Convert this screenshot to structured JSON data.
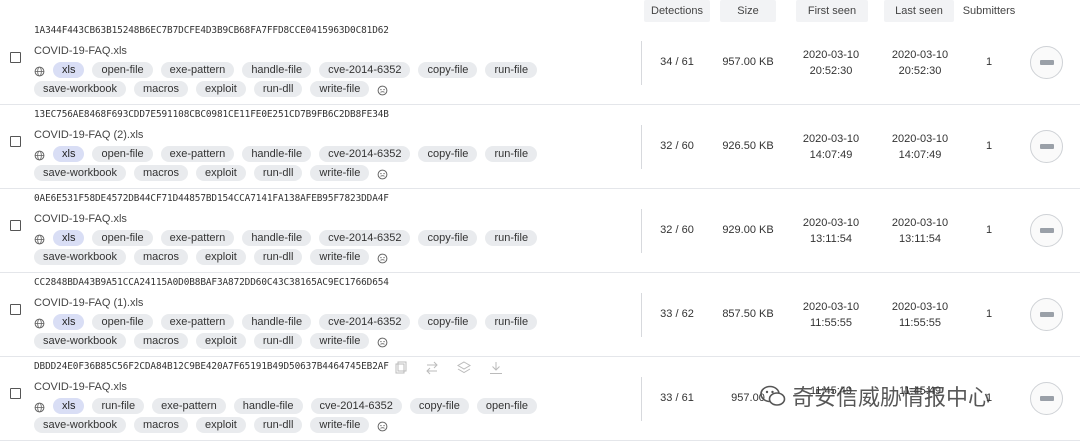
{
  "columns": {
    "detections": "Detections",
    "size": "Size",
    "first_seen": "First seen",
    "last_seen": "Last seen",
    "submitters": "Submitters"
  },
  "files": [
    {
      "hash": "1A344F443CB63B15248B6EC7B7DCFE4D3B9CB68FA7FFD8CCE0415963D0C81D62",
      "name": "COVID-19-FAQ.xls",
      "tags1": [
        "xls",
        "open-file",
        "exe-pattern",
        "handle-file",
        "cve-2014-6352",
        "copy-file",
        "run-file"
      ],
      "tags2": [
        "save-workbook",
        "macros",
        "exploit",
        "run-dll",
        "write-file"
      ],
      "detections": "34 / 61",
      "size": "957.00 KB",
      "first_date": "2020-03-10",
      "first_time": "20:52:30",
      "last_date": "2020-03-10",
      "last_time": "20:52:30",
      "submitters": "1"
    },
    {
      "hash": "13EC756AE8468F693CDD7E591108CBC0981CE11FE0E251CD7B9FB6C2DB8FE34B",
      "name": "COVID-19-FAQ (2).xls",
      "tags1": [
        "xls",
        "open-file",
        "exe-pattern",
        "handle-file",
        "cve-2014-6352",
        "copy-file",
        "run-file"
      ],
      "tags2": [
        "save-workbook",
        "macros",
        "exploit",
        "run-dll",
        "write-file"
      ],
      "detections": "32 / 60",
      "size": "926.50 KB",
      "first_date": "2020-03-10",
      "first_time": "14:07:49",
      "last_date": "2020-03-10",
      "last_time": "14:07:49",
      "submitters": "1"
    },
    {
      "hash": "0AE6E531F58DE4572DB44CF71D44857BD154CCA7141FA138AFEB95F7823DDA4F",
      "name": "COVID-19-FAQ.xls",
      "tags1": [
        "xls",
        "open-file",
        "exe-pattern",
        "handle-file",
        "cve-2014-6352",
        "copy-file",
        "run-file"
      ],
      "tags2": [
        "save-workbook",
        "macros",
        "exploit",
        "run-dll",
        "write-file"
      ],
      "detections": "32 / 60",
      "size": "929.00 KB",
      "first_date": "2020-03-10",
      "first_time": "13:11:54",
      "last_date": "2020-03-10",
      "last_time": "13:11:54",
      "submitters": "1"
    },
    {
      "hash": "CC2848BDA43B9A51CCA24115A0D0B8BAF3A872DD60C43C38165AC9EC1766D654",
      "name": "COVID-19-FAQ (1).xls",
      "tags1": [
        "xls",
        "open-file",
        "exe-pattern",
        "handle-file",
        "cve-2014-6352",
        "copy-file",
        "run-file"
      ],
      "tags2": [
        "save-workbook",
        "macros",
        "exploit",
        "run-dll",
        "write-file"
      ],
      "detections": "33 / 62",
      "size": "857.50 KB",
      "first_date": "2020-03-10",
      "first_time": "11:55:55",
      "last_date": "2020-03-10",
      "last_time": "11:55:55",
      "submitters": "1"
    },
    {
      "hash": "DBDD24E0F36B85C56F2CDA84B12C9BE420A7F65191B49D50637B4464745EB2AF",
      "name": "COVID-19-FAQ.xls",
      "tags1": [
        "xls",
        "run-file",
        "exe-pattern",
        "handle-file",
        "cve-2014-6352",
        "copy-file",
        "open-file"
      ],
      "tags2": [
        "save-workbook",
        "macros",
        "exploit",
        "run-dll",
        "write-file"
      ],
      "detections": "33 / 61",
      "size": "957.00",
      "first_date": "",
      "first_time": "11:45:49",
      "last_date": "",
      "last_time": "11:45:49",
      "submitters": "1"
    }
  ],
  "watermark": "奇安信威胁情报中心",
  "icons": {
    "tag_prefix": "globe-icon",
    "tag_suffix": "face-icon",
    "thumbnail": "file-thumbnail",
    "row_actions": [
      "copy-icon",
      "compare-icon",
      "similar-icon",
      "download-icon"
    ]
  }
}
